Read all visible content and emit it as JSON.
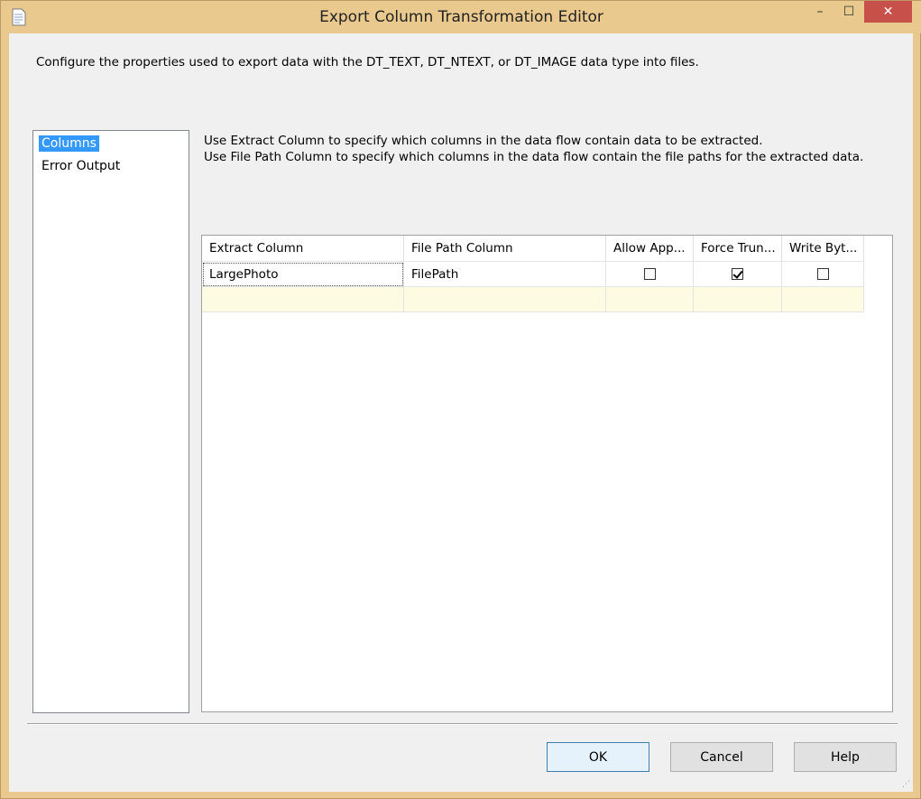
{
  "window": {
    "title": "Export Column Transformation Editor",
    "close_glyph": "✕",
    "minimize_glyph": "–",
    "maximize_glyph": "☐"
  },
  "description": "Configure the properties used to export data with the DT_TEXT, DT_NTEXT, or DT_IMAGE data type into files.",
  "nav": {
    "items": [
      {
        "label": "Columns",
        "selected": true
      },
      {
        "label": "Error Output",
        "selected": false
      }
    ]
  },
  "intro": {
    "line1": "Use Extract Column to specify which columns in the data flow contain data to be extracted.",
    "line2": "Use File Path Column to specify which columns in the data flow contain the file paths for the extracted data."
  },
  "grid": {
    "headers": [
      "Extract Column",
      "File Path Column",
      "Allow App...",
      "Force Trun...",
      "Write Byt..."
    ],
    "rows": [
      {
        "extract": "LargePhoto",
        "filepath": "FilePath",
        "allow_append": false,
        "force_truncate": true,
        "write_bom": false
      }
    ]
  },
  "buttons": {
    "ok": "OK",
    "cancel": "Cancel",
    "help": "Help"
  },
  "colors": {
    "selection": "#3399ff",
    "titlebar": "#e9c98e",
    "close_button": "#c7504b",
    "new_row": "#fdfce3"
  },
  "icons": {
    "app": "document-icon",
    "resize": "resize-grip-icon"
  }
}
